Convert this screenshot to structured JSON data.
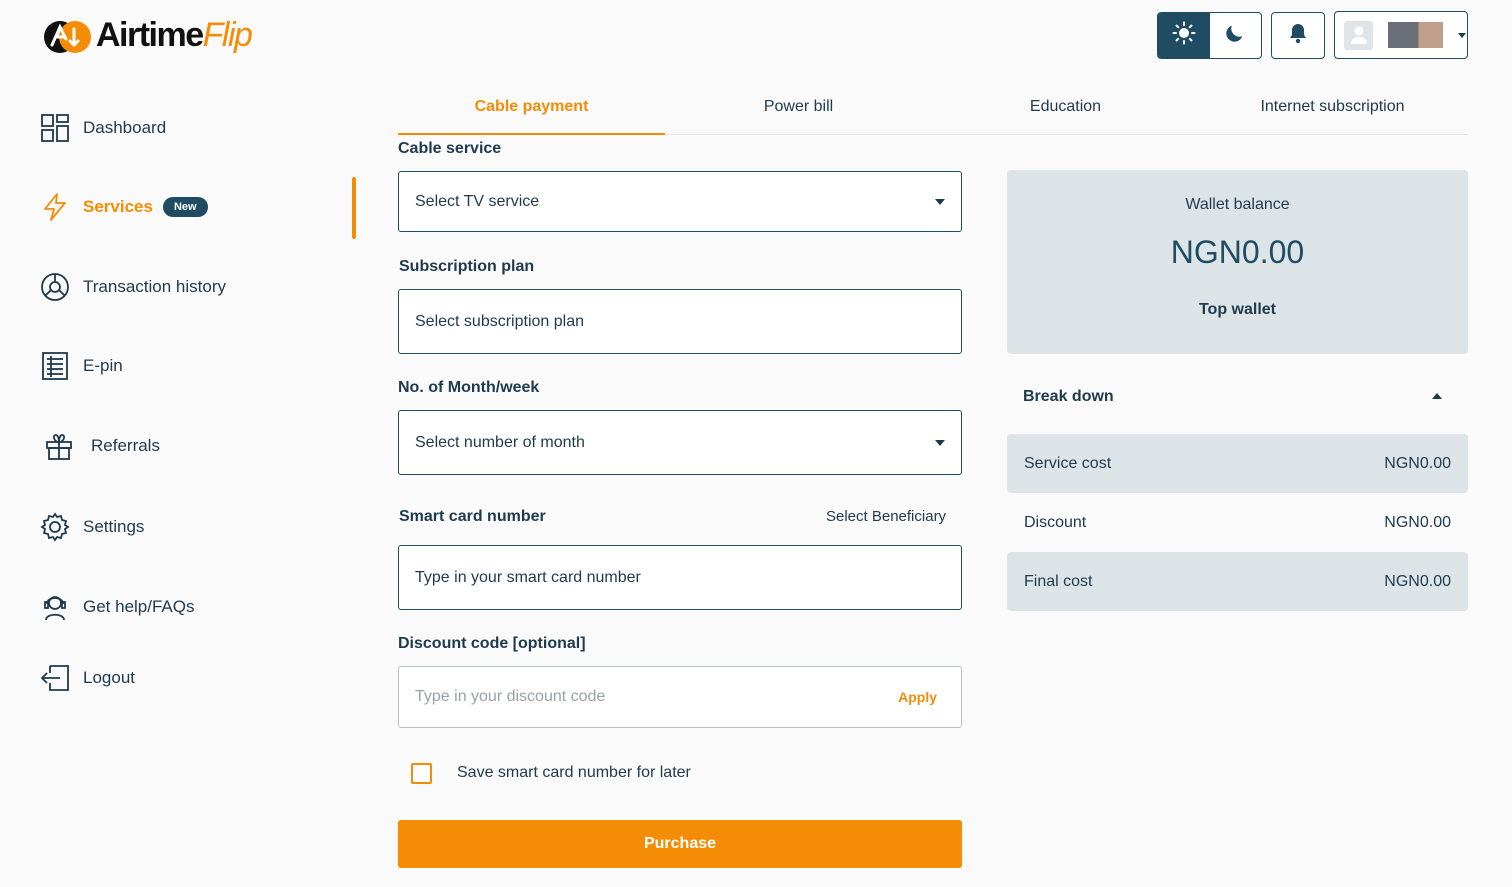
{
  "brand": {
    "name_part1": "Airtime",
    "name_part2": "Flip",
    "accent_color": "#f48c06",
    "primary_color": "#1f4b63"
  },
  "header": {
    "theme_light_icon": "sun-icon",
    "theme_dark_icon": "moon-icon",
    "notification_icon": "bell-icon",
    "profile_icon": "user-avatar-icon"
  },
  "sidebar": {
    "items": [
      {
        "label": "Dashboard",
        "icon": "grid-icon"
      },
      {
        "label": "Services",
        "icon": "lightning-icon",
        "badge": "New",
        "active": true
      },
      {
        "label": "Transaction history",
        "icon": "pie-chart-icon"
      },
      {
        "label": "E-pin",
        "icon": "list-icon"
      },
      {
        "label": "Referrals",
        "icon": "gift-icon"
      },
      {
        "label": "Settings",
        "icon": "gear-icon"
      },
      {
        "label": "Get help/FAQs",
        "icon": "support-icon"
      },
      {
        "label": "Logout",
        "icon": "logout-icon"
      }
    ]
  },
  "tabs": [
    {
      "label": "Cable payment",
      "active": true
    },
    {
      "label": "Power bill"
    },
    {
      "label": "Education"
    },
    {
      "label": "Internet subscription"
    }
  ],
  "form": {
    "cable_service": {
      "label": "Cable service",
      "value": "Select TV service"
    },
    "subscription_plan": {
      "label": "Subscription plan",
      "value": "Select subscription plan"
    },
    "months": {
      "label": "No. of Month/week",
      "value": "Select number of month"
    },
    "smart_card": {
      "label": "Smart card number",
      "link": "Select Beneficiary",
      "value": "Type in your smart card number"
    },
    "discount": {
      "label": "Discount code [optional]",
      "placeholder": "Type in your discount code",
      "apply": "Apply"
    },
    "save_label": "Save smart card number for later",
    "purchase_label": "Purchase"
  },
  "wallet": {
    "title": "Wallet balance",
    "amount": "NGN0.00",
    "top_label": "Top wallet"
  },
  "breakdown": {
    "title": "Break down",
    "rows": [
      {
        "label": "Service cost",
        "value": "NGN0.00"
      },
      {
        "label": "Discount",
        "value": "NGN0.00"
      },
      {
        "label": "Final cost",
        "value": "NGN0.00"
      }
    ]
  }
}
